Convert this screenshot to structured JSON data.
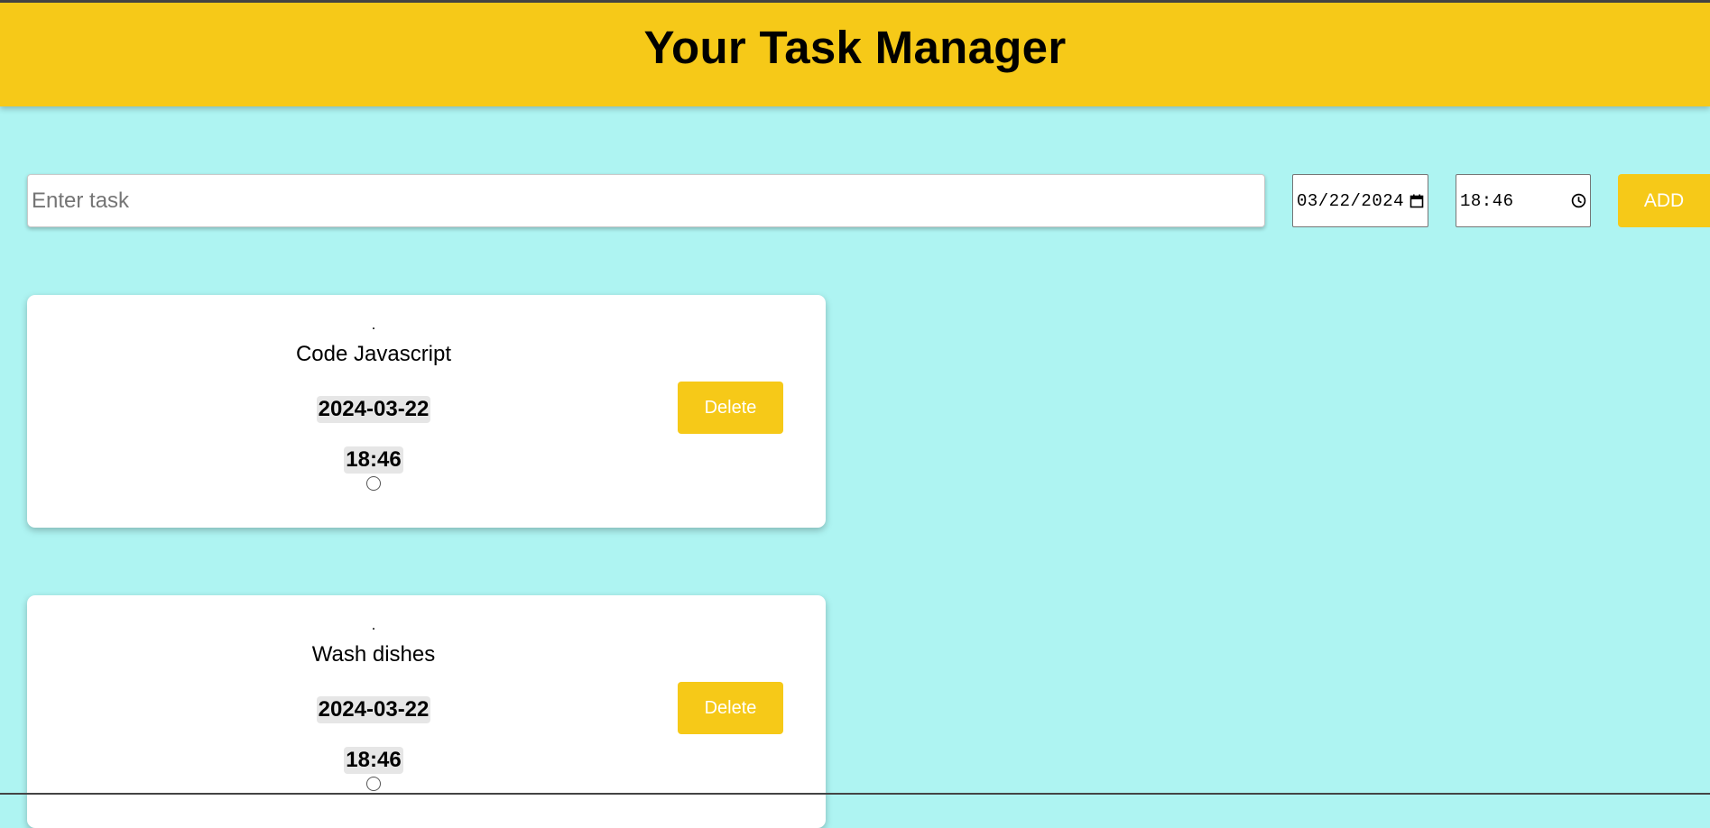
{
  "app": {
    "title": "Your Task Manager"
  },
  "form": {
    "task_placeholder": "Enter task",
    "task_value": "",
    "date_display": "03/22/2024",
    "time_display": "18:46",
    "add_label": "ADD",
    "date_icon": "calendar-icon",
    "time_icon": "clock-icon"
  },
  "tasks": [
    {
      "marker": ".",
      "title": "Code Javascript",
      "date": "2024-03-22",
      "time": "18:46",
      "delete_label": "Delete",
      "done": false
    },
    {
      "marker": ".",
      "title": "Wash dishes",
      "date": "2024-03-22",
      "time": "18:46",
      "delete_label": "Delete",
      "done": false
    }
  ],
  "colors": {
    "background": "#aef4f2",
    "accent": "#f6c918",
    "card": "#ffffff",
    "pill": "#e6e6e6"
  }
}
